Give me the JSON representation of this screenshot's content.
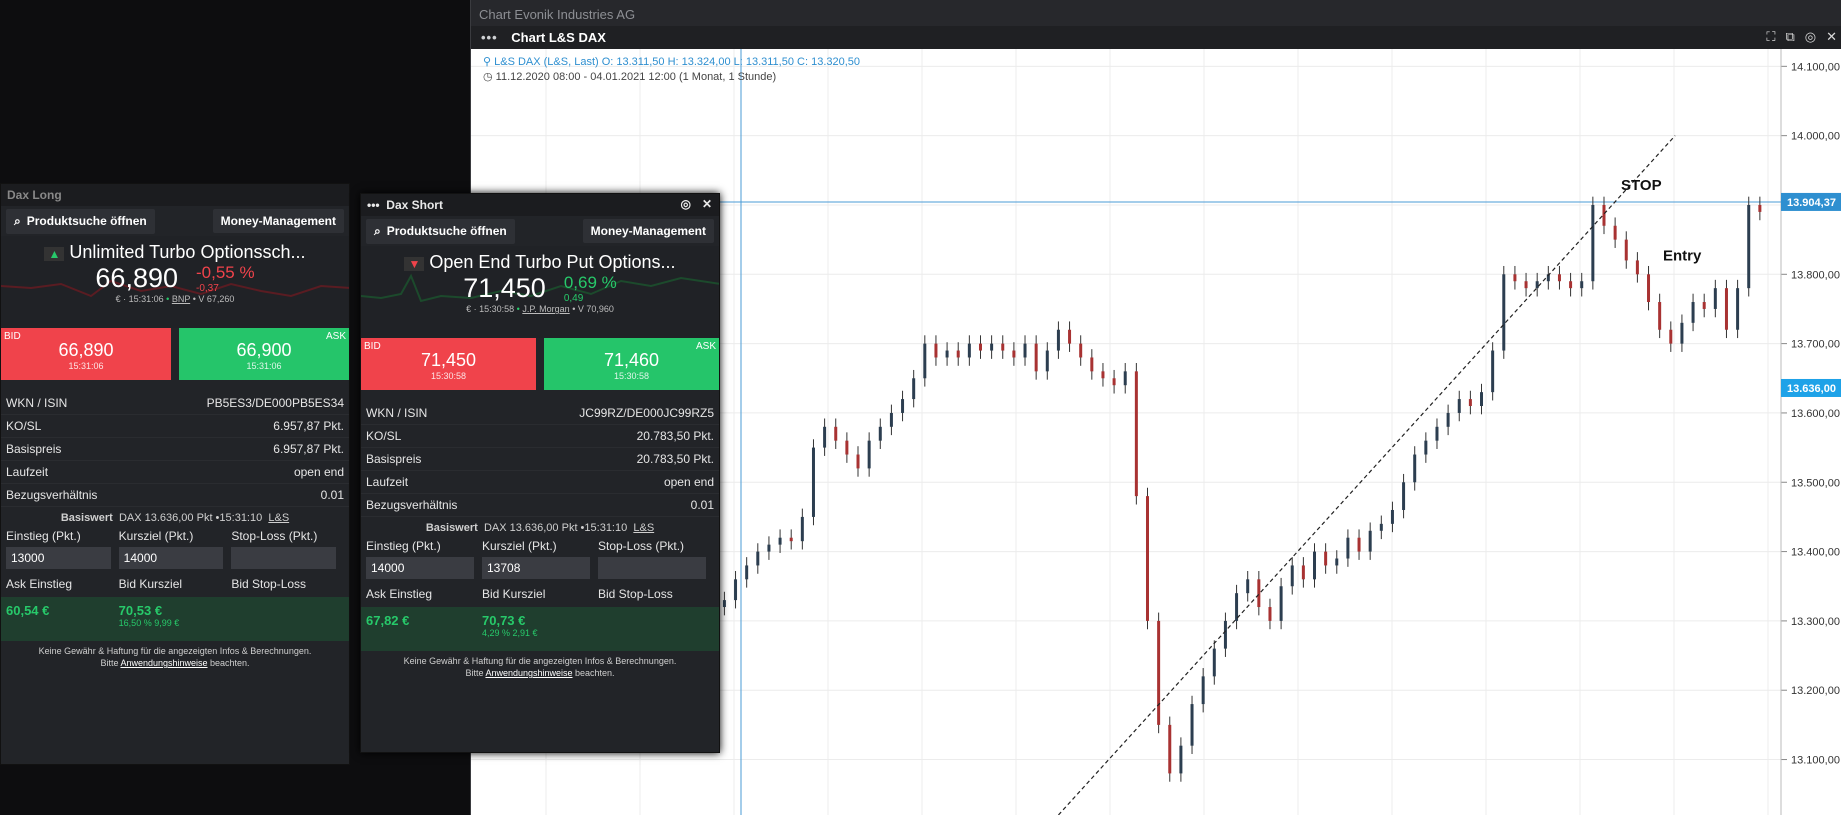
{
  "outer_window": {
    "title": "Chart Evonik Industries AG"
  },
  "chart_window": {
    "title": "Chart L&S DAX",
    "instrument_info": "L&S DAX (L&S, Last)  O: 13.311,50  H: 13.324,00  L: 13.311,50  C: 13.320,50",
    "period_info": "11.12.2020 08:00 - 04.01.2021 12:00   (1 Monat, 1 Stunde)",
    "annotations": {
      "stop": "STOP",
      "entry": "Entry"
    },
    "price_axis": [
      "14.100,00",
      "14.000,00",
      "13.900,00",
      "13.800,00",
      "13.700,00",
      "13.600,00",
      "13.500,00",
      "13.400,00",
      "13.300,00",
      "13.200,00",
      "13.100,00"
    ],
    "price_tags": [
      {
        "label": "13.904,37",
        "color": "#2e8fd0"
      },
      {
        "label": "13.636,00",
        "color": "#1ea2e8"
      }
    ]
  },
  "chart_data": {
    "type": "candlestick",
    "y_ticks": [
      14100,
      14000,
      13900,
      13800,
      13700,
      13600,
      13500,
      13400,
      13300,
      13200,
      13100
    ],
    "ylim": [
      13020,
      14125
    ],
    "horizontal_line": 13904.37,
    "current_price": 13636,
    "close_path": [
      13300,
      13315,
      13320,
      13330,
      13360,
      13380,
      13400,
      13410,
      13420,
      13415,
      13450,
      13550,
      13580,
      13560,
      13540,
      13520,
      13560,
      13580,
      13600,
      13620,
      13650,
      13700,
      13680,
      13690,
      13680,
      13700,
      13690,
      13700,
      13690,
      13680,
      13700,
      13660,
      13690,
      13720,
      13700,
      13680,
      13660,
      13650,
      13640,
      13660,
      13480,
      13300,
      13150,
      13080,
      13120,
      13180,
      13220,
      13260,
      13300,
      13340,
      13360,
      13320,
      13300,
      13350,
      13380,
      13360,
      13400,
      13380,
      13390,
      13420,
      13400,
      13430,
      13440,
      13460,
      13500,
      13540,
      13560,
      13580,
      13600,
      13620,
      13610,
      13630,
      13690,
      13800,
      13790,
      13780,
      13790,
      13800,
      13790,
      13780,
      13790,
      13900,
      13870,
      13850,
      13820,
      13800,
      13760,
      13720,
      13700,
      13730,
      13760,
      13750,
      13780,
      13720,
      13780,
      13900,
      13890
    ]
  },
  "dax_long": {
    "title": "Dax Long",
    "search_button": "Produktsuche öffnen",
    "money_button": "Money-Management",
    "product_name": "Unlimited Turbo Optionssch...",
    "price": "66,890",
    "change_pct": "-0,55 %",
    "change_abs": "-0,37",
    "meta_time": "€ · 15:31:06",
    "issuer": "BNP",
    "volume": "V 67,260",
    "bid_label": "BID",
    "bid": "66,890",
    "bid_time": "15:31:06",
    "ask_label": "ASK",
    "ask": "66,900",
    "ask_time": "15:31:06",
    "rows": [
      {
        "label": "WKN / ISIN",
        "value": "PB5ES3/DE000PB5ES34"
      },
      {
        "label": "KO/SL",
        "value": "6.957,87 Pkt."
      },
      {
        "label": "Basispreis",
        "value": "6.957,87 Pkt."
      },
      {
        "label": "Laufzeit",
        "value": "open end"
      },
      {
        "label": "Bezugsverhältnis",
        "value": "0.01"
      }
    ],
    "basis_label": "Basiswert",
    "basis_text": "DAX  13.636,00 Pkt  •15:31:10",
    "basis_link": "L&S",
    "einstieg_label": "Einstieg (Pkt.)",
    "kursziel_label": "Kursziel (Pkt.)",
    "stoploss_label": "Stop-Loss (Pkt.)",
    "einstieg_value": "13000",
    "kursziel_value": "14000",
    "ask_einstieg_label": "Ask Einstieg",
    "bid_kursziel_label": "Bid Kursziel",
    "bid_stoploss_label": "Bid Stop-Loss",
    "ask_einstieg": "60,54 €",
    "bid_kursziel": "70,53 €",
    "bid_kursziel_sub": "16,50 %  9,99 €",
    "disclaimer1": "Keine Gewähr & Haftung für die angezeigten Infos & Berechnungen.",
    "disclaimer2_pre": "Bitte ",
    "disclaimer2_link": "Anwendungshinweise",
    "disclaimer2_post": " beachten."
  },
  "dax_short": {
    "title": "Dax Short",
    "search_button": "Produktsuche öffnen",
    "money_button": "Money-Management",
    "product_name": "Open End Turbo Put Options...",
    "price": "71,450",
    "change_pct": "0,69 %",
    "change_abs": "0,49",
    "meta_time": "€ · 15:30:58",
    "issuer": "J.P. Morgan",
    "volume": "V 70,960",
    "bid_label": "BID",
    "bid": "71,450",
    "bid_time": "15:30:58",
    "ask_label": "ASK",
    "ask": "71,460",
    "ask_time": "15:30:58",
    "rows": [
      {
        "label": "WKN / ISIN",
        "value": "JC99RZ/DE000JC99RZ5"
      },
      {
        "label": "KO/SL",
        "value": "20.783,50 Pkt."
      },
      {
        "label": "Basispreis",
        "value": "20.783,50 Pkt."
      },
      {
        "label": "Laufzeit",
        "value": "open end"
      },
      {
        "label": "Bezugsverhältnis",
        "value": "0.01"
      }
    ],
    "basis_label": "Basiswert",
    "basis_text": "DAX  13.636,00 Pkt  •15:31:10",
    "basis_link": "L&S",
    "einstieg_label": "Einstieg (Pkt.)",
    "kursziel_label": "Kursziel (Pkt.)",
    "stoploss_label": "Stop-Loss (Pkt.)",
    "einstieg_value": "14000",
    "kursziel_value": "13708",
    "ask_einstieg_label": "Ask Einstieg",
    "bid_kursziel_label": "Bid Kursziel",
    "bid_stoploss_label": "Bid Stop-Loss",
    "ask_einstieg": "67,82 €",
    "bid_kursziel": "70,73 €",
    "bid_kursziel_sub": "4,29 %  2,91 €",
    "disclaimer1": "Keine Gewähr & Haftung für die angezeigten Infos & Berechnungen.",
    "disclaimer2_pre": "Bitte ",
    "disclaimer2_link": "Anwendungshinweise",
    "disclaimer2_post": " beachten."
  }
}
